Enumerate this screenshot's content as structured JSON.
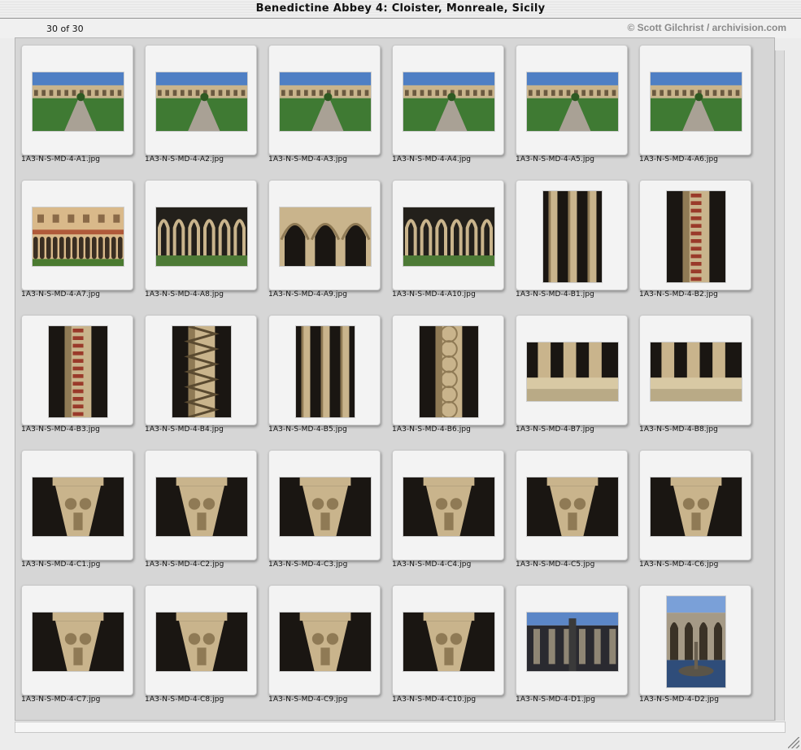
{
  "window": {
    "title": "Benedictine Abbey 4: Cloister, Monreale, Sicily"
  },
  "gallery": {
    "count_label": "30 of 30",
    "copyright": "© Scott Gilchrist / archivision.com",
    "items": [
      {
        "filename": "1A3-N-S-MD-4-A1.jpg",
        "orientation": "landscape",
        "scene": "cloister-garden"
      },
      {
        "filename": "1A3-N-S-MD-4-A2.jpg",
        "orientation": "landscape",
        "scene": "cloister-garden"
      },
      {
        "filename": "1A3-N-S-MD-4-A3.jpg",
        "orientation": "landscape",
        "scene": "cloister-garden"
      },
      {
        "filename": "1A3-N-S-MD-4-A4.jpg",
        "orientation": "landscape",
        "scene": "cloister-garden"
      },
      {
        "filename": "1A3-N-S-MD-4-A5.jpg",
        "orientation": "landscape",
        "scene": "cloister-garden"
      },
      {
        "filename": "1A3-N-S-MD-4-A6.jpg",
        "orientation": "landscape",
        "scene": "cloister-garden"
      },
      {
        "filename": "1A3-N-S-MD-4-A7.jpg",
        "orientation": "landscape",
        "scene": "arcade-facade"
      },
      {
        "filename": "1A3-N-S-MD-4-A8.jpg",
        "orientation": "landscape",
        "scene": "arcade"
      },
      {
        "filename": "1A3-N-S-MD-4-A9.jpg",
        "orientation": "landscape",
        "scene": "arches"
      },
      {
        "filename": "1A3-N-S-MD-4-A10.jpg",
        "orientation": "landscape",
        "scene": "arcade"
      },
      {
        "filename": "1A3-N-S-MD-4-B1.jpg",
        "orientation": "portrait",
        "scene": "columns"
      },
      {
        "filename": "1A3-N-S-MD-4-B2.jpg",
        "orientation": "portrait",
        "scene": "mosaic-column"
      },
      {
        "filename": "1A3-N-S-MD-4-B3.jpg",
        "orientation": "portrait",
        "scene": "mosaic-column"
      },
      {
        "filename": "1A3-N-S-MD-4-B4.jpg",
        "orientation": "portrait",
        "scene": "zigzag-column"
      },
      {
        "filename": "1A3-N-S-MD-4-B5.jpg",
        "orientation": "portrait",
        "scene": "columns"
      },
      {
        "filename": "1A3-N-S-MD-4-B6.jpg",
        "orientation": "portrait",
        "scene": "carved-column"
      },
      {
        "filename": "1A3-N-S-MD-4-B7.jpg",
        "orientation": "landscape",
        "scene": "column-bases"
      },
      {
        "filename": "1A3-N-S-MD-4-B8.jpg",
        "orientation": "landscape",
        "scene": "column-bases"
      },
      {
        "filename": "1A3-N-S-MD-4-C1.jpg",
        "orientation": "landscape",
        "scene": "capital"
      },
      {
        "filename": "1A3-N-S-MD-4-C2.jpg",
        "orientation": "landscape",
        "scene": "capital"
      },
      {
        "filename": "1A3-N-S-MD-4-C3.jpg",
        "orientation": "landscape",
        "scene": "capital"
      },
      {
        "filename": "1A3-N-S-MD-4-C4.jpg",
        "orientation": "landscape",
        "scene": "capital"
      },
      {
        "filename": "1A3-N-S-MD-4-C5.jpg",
        "orientation": "landscape",
        "scene": "capital"
      },
      {
        "filename": "1A3-N-S-MD-4-C6.jpg",
        "orientation": "landscape",
        "scene": "capital"
      },
      {
        "filename": "1A3-N-S-MD-4-C7.jpg",
        "orientation": "landscape",
        "scene": "capital"
      },
      {
        "filename": "1A3-N-S-MD-4-C8.jpg",
        "orientation": "landscape",
        "scene": "capital"
      },
      {
        "filename": "1A3-N-S-MD-4-C9.jpg",
        "orientation": "landscape",
        "scene": "capital"
      },
      {
        "filename": "1A3-N-S-MD-4-C10.jpg",
        "orientation": "landscape",
        "scene": "capital"
      },
      {
        "filename": "1A3-N-S-MD-4-D1.jpg",
        "orientation": "landscape",
        "scene": "fountain-court"
      },
      {
        "filename": "1A3-N-S-MD-4-D2.jpg",
        "orientation": "portrait",
        "scene": "fountain"
      }
    ]
  }
}
